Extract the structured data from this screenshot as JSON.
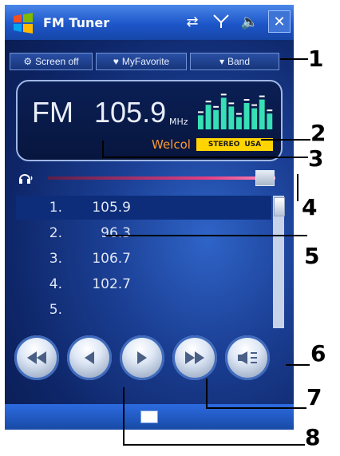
{
  "app": {
    "title": "FM Tuner"
  },
  "menu": {
    "screen_off": "Screen off",
    "favorite": "MyFavorite",
    "band": "Band"
  },
  "display": {
    "band": "FM",
    "frequency": "105.9",
    "unit": "MHz",
    "rds_text": "Welcol",
    "stereo_label": "STEREO",
    "region_label": "USA",
    "spectrum_levels": [
      0.4,
      0.7,
      0.55,
      0.9,
      0.65,
      0.35,
      0.75,
      0.6,
      0.85,
      0.45
    ]
  },
  "volume": {
    "level": 0.95
  },
  "list": {
    "items": [
      {
        "num": "1.",
        "freq": "105.9",
        "selected": true
      },
      {
        "num": "2.",
        "freq": "96.3",
        "selected": false
      },
      {
        "num": "3.",
        "freq": "106.7",
        "selected": false
      },
      {
        "num": "4.",
        "freq": "102.7",
        "selected": false
      },
      {
        "num": "5.",
        "freq": "",
        "selected": false
      }
    ]
  },
  "controls": [
    {
      "name": "rewind",
      "icon": "fast-rewind-icon"
    },
    {
      "name": "prev",
      "icon": "prev-icon"
    },
    {
      "name": "next",
      "icon": "next-icon"
    },
    {
      "name": "fast-forward",
      "icon": "fast-forward-icon"
    },
    {
      "name": "mute",
      "icon": "speaker-mute-icon"
    }
  ],
  "callouts": [
    "1",
    "2",
    "3",
    "4",
    "5",
    "6",
    "7",
    "8"
  ],
  "colors": {
    "title_bar": "#1d56c9",
    "rds_text": "#ff9a2e",
    "stereo_badge": "#ffd400",
    "volume": "#e33f83"
  }
}
